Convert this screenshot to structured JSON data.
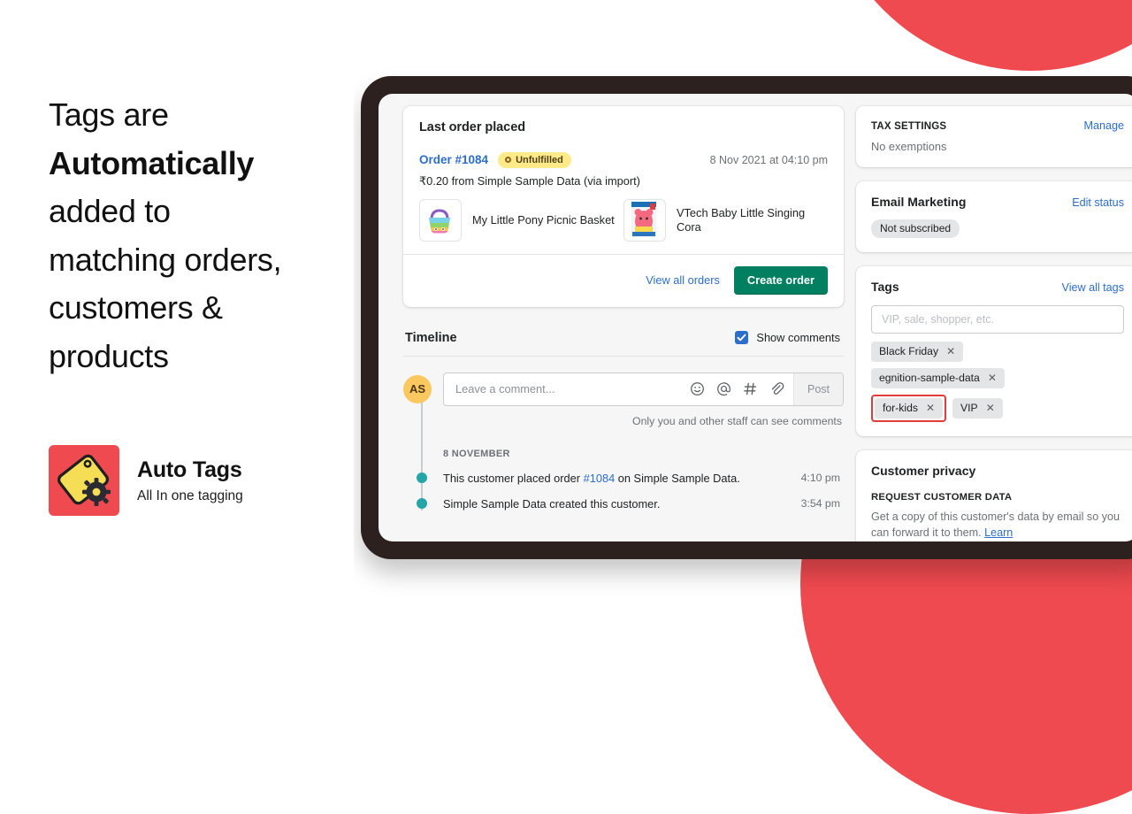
{
  "marketing": {
    "headline_part1": "Tags are",
    "headline_bold": "Automatically",
    "headline_part2": "added to",
    "headline_part3": "matching orders,",
    "headline_part4": "customers &",
    "headline_part5": "products",
    "brand_name": "Auto Tags",
    "brand_tagline": "All In one tagging",
    "brand_color": "#ef4a50",
    "accent_circle_color": "#ef4a4f"
  },
  "order_card": {
    "title": "Last order placed",
    "order_link": "Order #1084",
    "status_badge": "Unfulfilled",
    "date": "8 Nov 2021 at 04:10 pm",
    "amount_line": "₹0.20 from Simple Sample Data (via import)",
    "products": [
      {
        "name": "My Little Pony Picnic Basket"
      },
      {
        "name": "VTech Baby Little Singing Cora"
      }
    ],
    "view_all_orders": "View all orders",
    "create_order": "Create order"
  },
  "timeline": {
    "title": "Timeline",
    "show_comments_label": "Show comments",
    "show_comments_checked": true,
    "avatar_initials": "AS",
    "comment_placeholder": "Leave a comment...",
    "post_label": "Post",
    "staff_note": "Only you and other staff can see comments",
    "date_group": "8 NOVEMBER",
    "events": [
      {
        "text_before": "This customer placed order ",
        "link": "#1084",
        "text_after": " on Simple Sample Data.",
        "time": "4:10 pm"
      },
      {
        "text_before": "Simple Sample Data created this customer.",
        "link": "",
        "text_after": "",
        "time": "3:54 pm"
      }
    ],
    "icons": [
      "emoji-icon",
      "mention-icon",
      "hashtag-icon",
      "attachment-icon"
    ]
  },
  "sidebar": {
    "tax": {
      "title": "TAX SETTINGS",
      "action": "Manage",
      "value": "No exemptions"
    },
    "email_marketing": {
      "title": "Email Marketing",
      "action": "Edit status",
      "status": "Not subscribed"
    },
    "tags": {
      "title": "Tags",
      "action": "View all tags",
      "input_placeholder": "VIP, sale, shopper, etc.",
      "input_value": "",
      "chips": [
        {
          "label": "Black Friday",
          "highlighted": false
        },
        {
          "label": "egnition-sample-data",
          "highlighted": false
        },
        {
          "label": "for-kids",
          "highlighted": true
        },
        {
          "label": "VIP",
          "highlighted": false
        }
      ],
      "highlight_color": "#e23b3b"
    },
    "privacy": {
      "title": "Customer privacy",
      "subtitle": "REQUEST CUSTOMER DATA",
      "text_before": "Get a copy of this customer's data by email so you can forward it to them. ",
      "link": "Learn"
    }
  }
}
